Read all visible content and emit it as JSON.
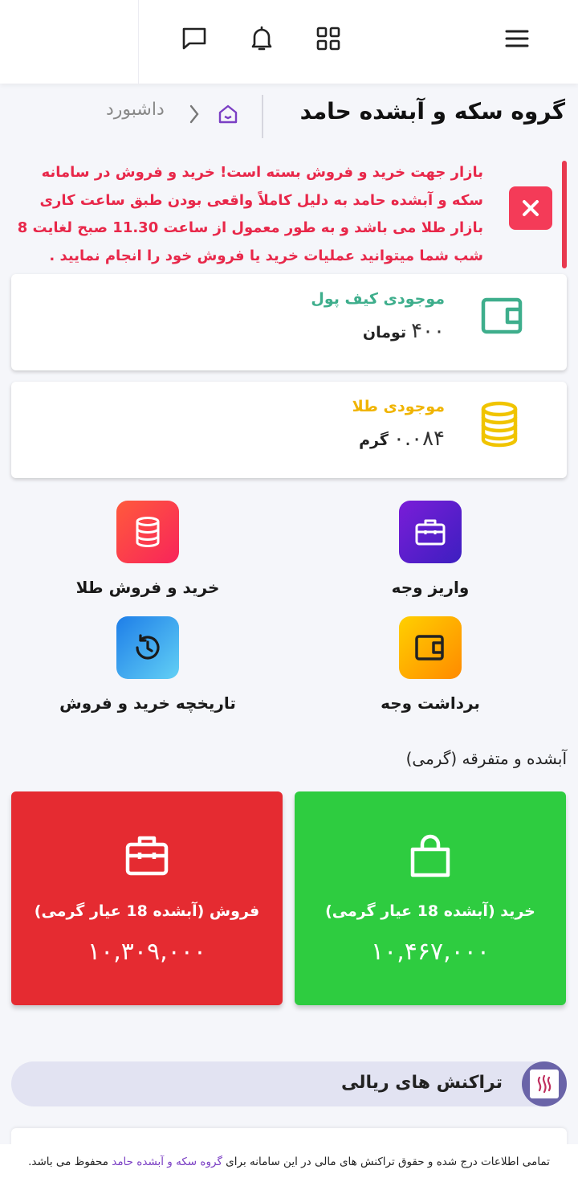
{
  "topbar": {
    "icons": [
      "menu-icon",
      "grid-icon",
      "bell-icon",
      "chat-icon"
    ]
  },
  "header": {
    "title": "گروه سکه و آبشده حامد",
    "breadcrumb": "داشبورد"
  },
  "alert": {
    "message": "بازار جهت خرید و فروش بسته است! خرید و فروش در سامانه سکه و آبشده حامد به دلیل کاملاً واقعی بودن طبق ساعت کاری بازار طلا می باشد و به طور معمول از ساعت 11.30 صبح لغایت 8 شب شما میتوانید عملیات خرید یا فروش خود را انجام نمایید .",
    "color": "#e8284a"
  },
  "wallet": {
    "label": "موجودی کیف پول",
    "amount": "۴۰۰",
    "unit": "تومان",
    "color": "#3eae8c"
  },
  "gold": {
    "label": "موجودی طلا",
    "amount": "۰.۰۸۴",
    "unit": "گرم",
    "color": "#f0b400"
  },
  "actions": {
    "deposit": "واریز وجه",
    "buy_sell_gold": "خرید و فروش طلا",
    "withdraw": "برداشت وجه",
    "history": "تاریخچه خرید و فروش"
  },
  "section_title": "آبشده و متفرقه (گرمی)",
  "prices": {
    "buy": {
      "title": "خرید (آبشده 18 عیار گرمی)",
      "value": "۱۰,۴۶۷,۰۰۰",
      "color": "#2ecc40"
    },
    "sell": {
      "title": "فروش (آبشده 18 عیار گرمی)",
      "value": "۱۰,۳۰۹,۰۰۰",
      "color": "#e52b31"
    }
  },
  "transactions": {
    "title": "تراکنش های ریالی"
  },
  "footer": {
    "before": "تمامی اطلاعات درج شده و حقوق تراکنش های مالی در این سامانه برای ",
    "brand": "گروه سکه و آبشده حامد",
    "after": " محفوظ می باشد."
  }
}
